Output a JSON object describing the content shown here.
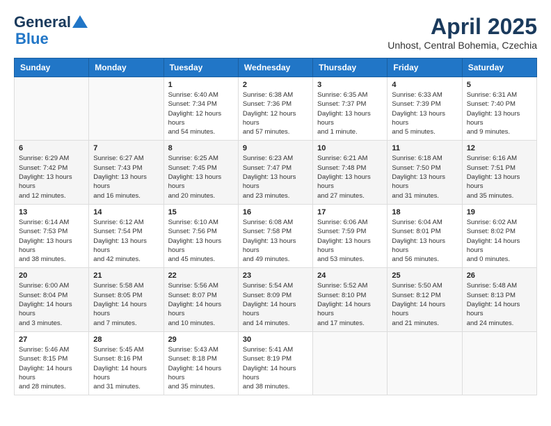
{
  "header": {
    "logo_line1": "General",
    "logo_line2": "Blue",
    "month": "April 2025",
    "location": "Unhost, Central Bohemia, Czechia"
  },
  "weekdays": [
    "Sunday",
    "Monday",
    "Tuesday",
    "Wednesday",
    "Thursday",
    "Friday",
    "Saturday"
  ],
  "weeks": [
    [
      {
        "day": "",
        "sunrise": "",
        "sunset": "",
        "daylight": ""
      },
      {
        "day": "",
        "sunrise": "",
        "sunset": "",
        "daylight": ""
      },
      {
        "day": "1",
        "sunrise": "Sunrise: 6:40 AM",
        "sunset": "Sunset: 7:34 PM",
        "daylight": "Daylight: 12 hours and 54 minutes."
      },
      {
        "day": "2",
        "sunrise": "Sunrise: 6:38 AM",
        "sunset": "Sunset: 7:36 PM",
        "daylight": "Daylight: 12 hours and 57 minutes."
      },
      {
        "day": "3",
        "sunrise": "Sunrise: 6:35 AM",
        "sunset": "Sunset: 7:37 PM",
        "daylight": "Daylight: 13 hours and 1 minute."
      },
      {
        "day": "4",
        "sunrise": "Sunrise: 6:33 AM",
        "sunset": "Sunset: 7:39 PM",
        "daylight": "Daylight: 13 hours and 5 minutes."
      },
      {
        "day": "5",
        "sunrise": "Sunrise: 6:31 AM",
        "sunset": "Sunset: 7:40 PM",
        "daylight": "Daylight: 13 hours and 9 minutes."
      }
    ],
    [
      {
        "day": "6",
        "sunrise": "Sunrise: 6:29 AM",
        "sunset": "Sunset: 7:42 PM",
        "daylight": "Daylight: 13 hours and 12 minutes."
      },
      {
        "day": "7",
        "sunrise": "Sunrise: 6:27 AM",
        "sunset": "Sunset: 7:43 PM",
        "daylight": "Daylight: 13 hours and 16 minutes."
      },
      {
        "day": "8",
        "sunrise": "Sunrise: 6:25 AM",
        "sunset": "Sunset: 7:45 PM",
        "daylight": "Daylight: 13 hours and 20 minutes."
      },
      {
        "day": "9",
        "sunrise": "Sunrise: 6:23 AM",
        "sunset": "Sunset: 7:47 PM",
        "daylight": "Daylight: 13 hours and 23 minutes."
      },
      {
        "day": "10",
        "sunrise": "Sunrise: 6:21 AM",
        "sunset": "Sunset: 7:48 PM",
        "daylight": "Daylight: 13 hours and 27 minutes."
      },
      {
        "day": "11",
        "sunrise": "Sunrise: 6:18 AM",
        "sunset": "Sunset: 7:50 PM",
        "daylight": "Daylight: 13 hours and 31 minutes."
      },
      {
        "day": "12",
        "sunrise": "Sunrise: 6:16 AM",
        "sunset": "Sunset: 7:51 PM",
        "daylight": "Daylight: 13 hours and 35 minutes."
      }
    ],
    [
      {
        "day": "13",
        "sunrise": "Sunrise: 6:14 AM",
        "sunset": "Sunset: 7:53 PM",
        "daylight": "Daylight: 13 hours and 38 minutes."
      },
      {
        "day": "14",
        "sunrise": "Sunrise: 6:12 AM",
        "sunset": "Sunset: 7:54 PM",
        "daylight": "Daylight: 13 hours and 42 minutes."
      },
      {
        "day": "15",
        "sunrise": "Sunrise: 6:10 AM",
        "sunset": "Sunset: 7:56 PM",
        "daylight": "Daylight: 13 hours and 45 minutes."
      },
      {
        "day": "16",
        "sunrise": "Sunrise: 6:08 AM",
        "sunset": "Sunset: 7:58 PM",
        "daylight": "Daylight: 13 hours and 49 minutes."
      },
      {
        "day": "17",
        "sunrise": "Sunrise: 6:06 AM",
        "sunset": "Sunset: 7:59 PM",
        "daylight": "Daylight: 13 hours and 53 minutes."
      },
      {
        "day": "18",
        "sunrise": "Sunrise: 6:04 AM",
        "sunset": "Sunset: 8:01 PM",
        "daylight": "Daylight: 13 hours and 56 minutes."
      },
      {
        "day": "19",
        "sunrise": "Sunrise: 6:02 AM",
        "sunset": "Sunset: 8:02 PM",
        "daylight": "Daylight: 14 hours and 0 minutes."
      }
    ],
    [
      {
        "day": "20",
        "sunrise": "Sunrise: 6:00 AM",
        "sunset": "Sunset: 8:04 PM",
        "daylight": "Daylight: 14 hours and 3 minutes."
      },
      {
        "day": "21",
        "sunrise": "Sunrise: 5:58 AM",
        "sunset": "Sunset: 8:05 PM",
        "daylight": "Daylight: 14 hours and 7 minutes."
      },
      {
        "day": "22",
        "sunrise": "Sunrise: 5:56 AM",
        "sunset": "Sunset: 8:07 PM",
        "daylight": "Daylight: 14 hours and 10 minutes."
      },
      {
        "day": "23",
        "sunrise": "Sunrise: 5:54 AM",
        "sunset": "Sunset: 8:09 PM",
        "daylight": "Daylight: 14 hours and 14 minutes."
      },
      {
        "day": "24",
        "sunrise": "Sunrise: 5:52 AM",
        "sunset": "Sunset: 8:10 PM",
        "daylight": "Daylight: 14 hours and 17 minutes."
      },
      {
        "day": "25",
        "sunrise": "Sunrise: 5:50 AM",
        "sunset": "Sunset: 8:12 PM",
        "daylight": "Daylight: 14 hours and 21 minutes."
      },
      {
        "day": "26",
        "sunrise": "Sunrise: 5:48 AM",
        "sunset": "Sunset: 8:13 PM",
        "daylight": "Daylight: 14 hours and 24 minutes."
      }
    ],
    [
      {
        "day": "27",
        "sunrise": "Sunrise: 5:46 AM",
        "sunset": "Sunset: 8:15 PM",
        "daylight": "Daylight: 14 hours and 28 minutes."
      },
      {
        "day": "28",
        "sunrise": "Sunrise: 5:45 AM",
        "sunset": "Sunset: 8:16 PM",
        "daylight": "Daylight: 14 hours and 31 minutes."
      },
      {
        "day": "29",
        "sunrise": "Sunrise: 5:43 AM",
        "sunset": "Sunset: 8:18 PM",
        "daylight": "Daylight: 14 hours and 35 minutes."
      },
      {
        "day": "30",
        "sunrise": "Sunrise: 5:41 AM",
        "sunset": "Sunset: 8:19 PM",
        "daylight": "Daylight: 14 hours and 38 minutes."
      },
      {
        "day": "",
        "sunrise": "",
        "sunset": "",
        "daylight": ""
      },
      {
        "day": "",
        "sunrise": "",
        "sunset": "",
        "daylight": ""
      },
      {
        "day": "",
        "sunrise": "",
        "sunset": "",
        "daylight": ""
      }
    ]
  ]
}
